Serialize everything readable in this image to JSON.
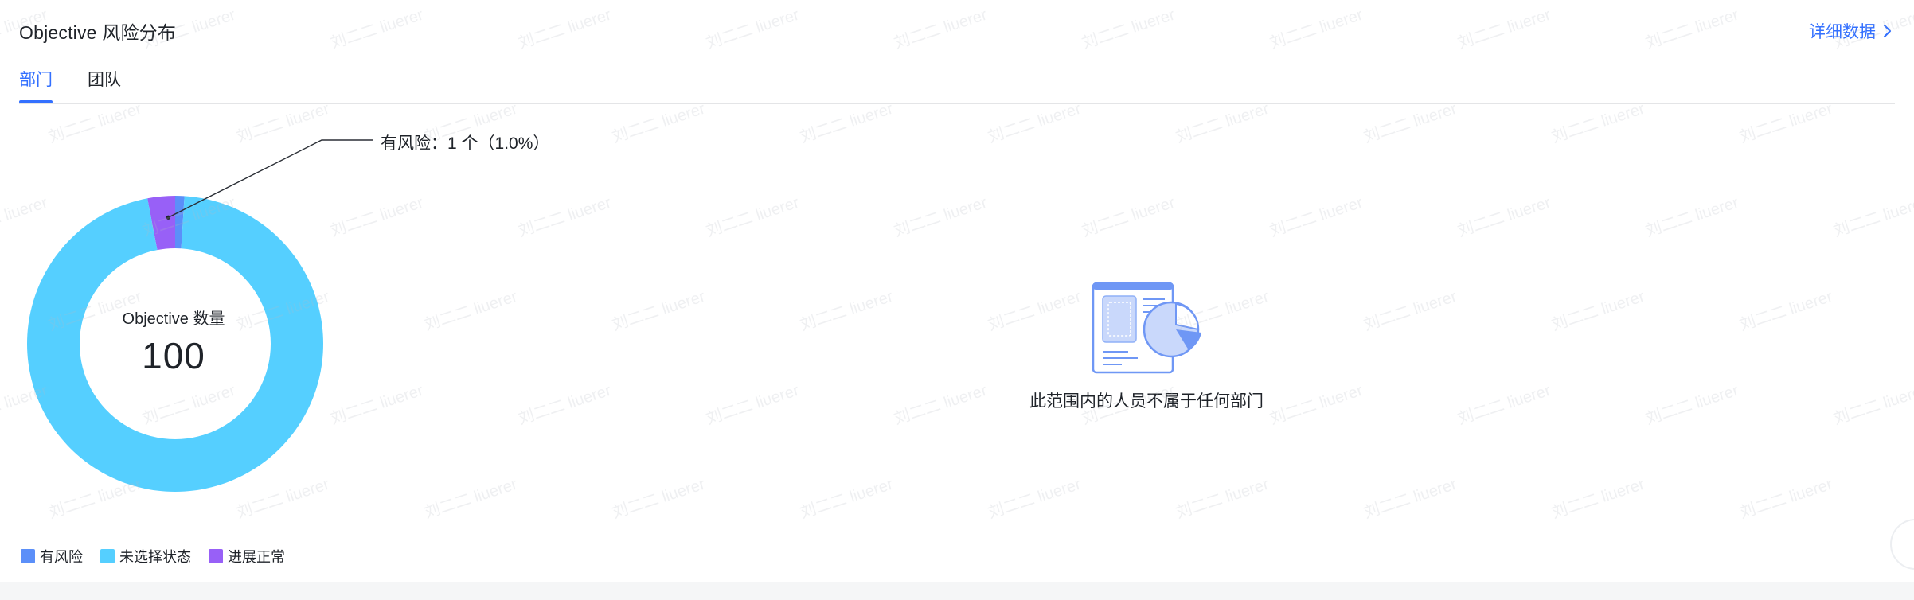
{
  "header": {
    "title": "Objective 风险分布",
    "detail_link": "详细数据"
  },
  "tabs": [
    {
      "label": "部门",
      "active": true
    },
    {
      "label": "团队",
      "active": false
    }
  ],
  "chart_data": {
    "type": "pie",
    "donut": true,
    "center_label": "Objective 数量",
    "center_value": "100",
    "slices": [
      {
        "name": "有风险",
        "value": 1,
        "color": "#5b8ff9"
      },
      {
        "name": "未选择状态",
        "value": 96,
        "color": "#55cfff"
      },
      {
        "name": "进展正常",
        "value": 3,
        "color": "#9860f7"
      }
    ],
    "callout": "有风险：1 个（1.0%）",
    "legend_position": "bottom-left"
  },
  "legend": [
    {
      "label": "有风险",
      "color": "#5b8ff9"
    },
    {
      "label": "未选择状态",
      "color": "#55cfff"
    },
    {
      "label": "进展正常",
      "color": "#9860f7"
    }
  ],
  "empty_state": {
    "text": "此范围内的人员不属于任何部门",
    "icon": "chart-document-illustration"
  },
  "watermark": {
    "line1": "刘二二",
    "line2": "liuerer"
  },
  "colors": {
    "accent": "#3370ff",
    "text": "#1f2329",
    "divider": "#e4e5e7"
  }
}
